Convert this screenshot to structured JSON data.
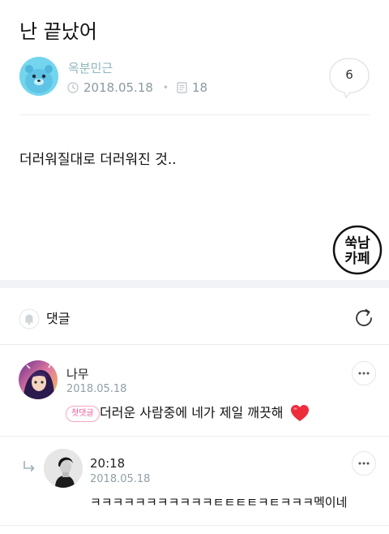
{
  "post": {
    "title": "난 끝났어",
    "author": "옥분민근",
    "date": "2018.05.18",
    "views": "18",
    "comment_count": "6",
    "body": "더러워질대로 더러워진 것.."
  },
  "watermark": {
    "line1": "쑥남",
    "line2": "카페"
  },
  "comments_section": {
    "title": "댓글"
  },
  "comments": [
    {
      "author": "나무",
      "date": "2018.05.18",
      "badge": "첫댓글",
      "text": "더러운 사람중에 네가 제일 깨끗해"
    },
    {
      "author": "20:18",
      "date": "2018.05.18",
      "text": "ㅋㅋㅋㅋㅋㅋㅋㅋㅋㅋㅋㅌㅌㅌㅌㅋㅌㅋㅋㅋ멕이네"
    }
  ],
  "colors": {
    "author_name": "#8fb6bb",
    "meta": "#8a9aa0",
    "badge": "#ec5b96",
    "heart": "#ee2d3c",
    "section_gap": "#f1f3f6"
  },
  "icons": {
    "clock": "clock-icon",
    "views": "document-icon",
    "comment": "speech-bubble-icon",
    "bell": "bell-icon",
    "refresh": "refresh-icon",
    "more": "more-dots-icon",
    "reply": "reply-arrow-icon",
    "heart": "heart-icon"
  }
}
